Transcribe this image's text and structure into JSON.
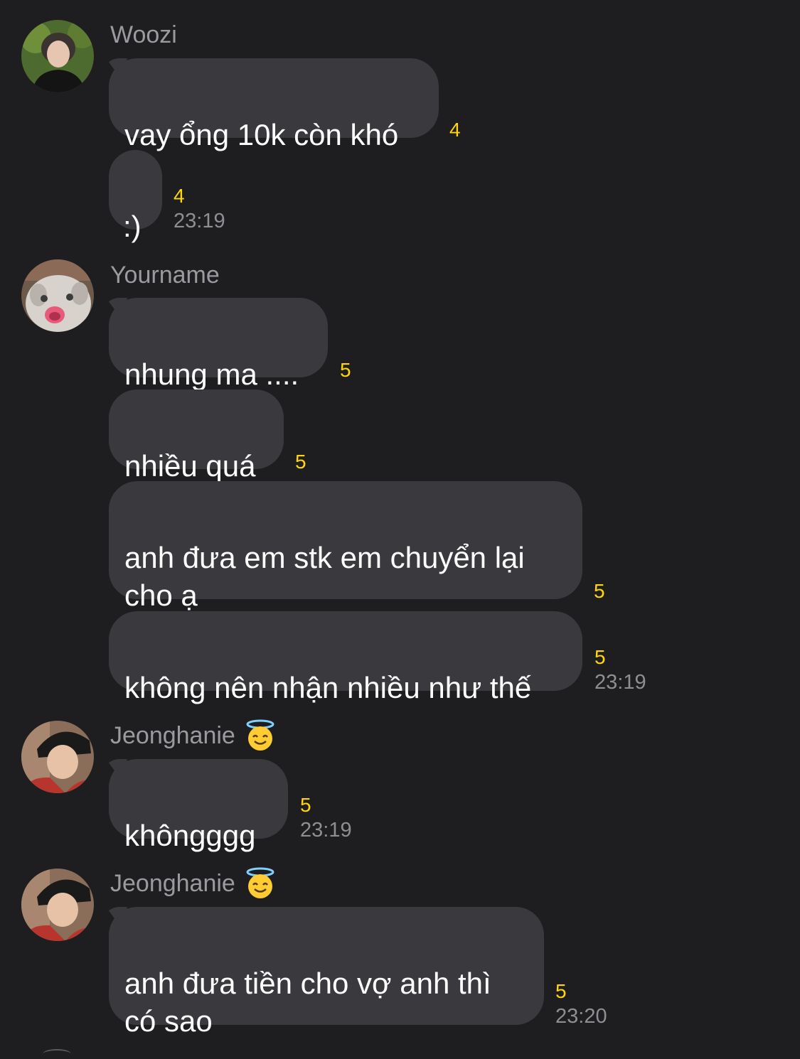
{
  "messages": [
    {
      "sender": "Woozi",
      "avatar": "woozi-avatar",
      "bubbles": [
        {
          "text": "vay ổng 10k còn khó",
          "count": "4"
        },
        {
          "text": ":)",
          "count": "4",
          "time": "23:19"
        }
      ]
    },
    {
      "sender": "Yourname",
      "avatar": "cat-avatar",
      "bubbles": [
        {
          "text": "nhung ma ....",
          "count": "5"
        },
        {
          "text": "nhiều quá",
          "count": "5"
        },
        {
          "text": "anh đưa em stk em chuyển lại\ncho ạ",
          "count": "5"
        },
        {
          "text": "không nên nhận nhiều như thế",
          "count": "5",
          "time": "23:19"
        }
      ]
    },
    {
      "sender": "Jeonghanie",
      "sender_emoji": "smiling-face-with-halo-icon",
      "avatar": "jeonghanie-avatar",
      "bubbles": [
        {
          "text": "khôngggg",
          "count": "5",
          "time": "23:19"
        }
      ]
    },
    {
      "sender": "Jeonghanie",
      "sender_emoji": "smiling-face-with-halo-icon",
      "avatar": "jeonghanie-avatar",
      "bubbles": [
        {
          "text": "anh đưa tiền cho vợ anh thì\ncó sao",
          "count": "5",
          "time": "23:20"
        }
      ]
    }
  ],
  "colors": {
    "background": "#1e1e20",
    "bubble": "#3a3a3e",
    "text": "#ffffff",
    "sender": "#9a9a9f",
    "count": "#ffd60a",
    "time": "#8e8e93"
  }
}
